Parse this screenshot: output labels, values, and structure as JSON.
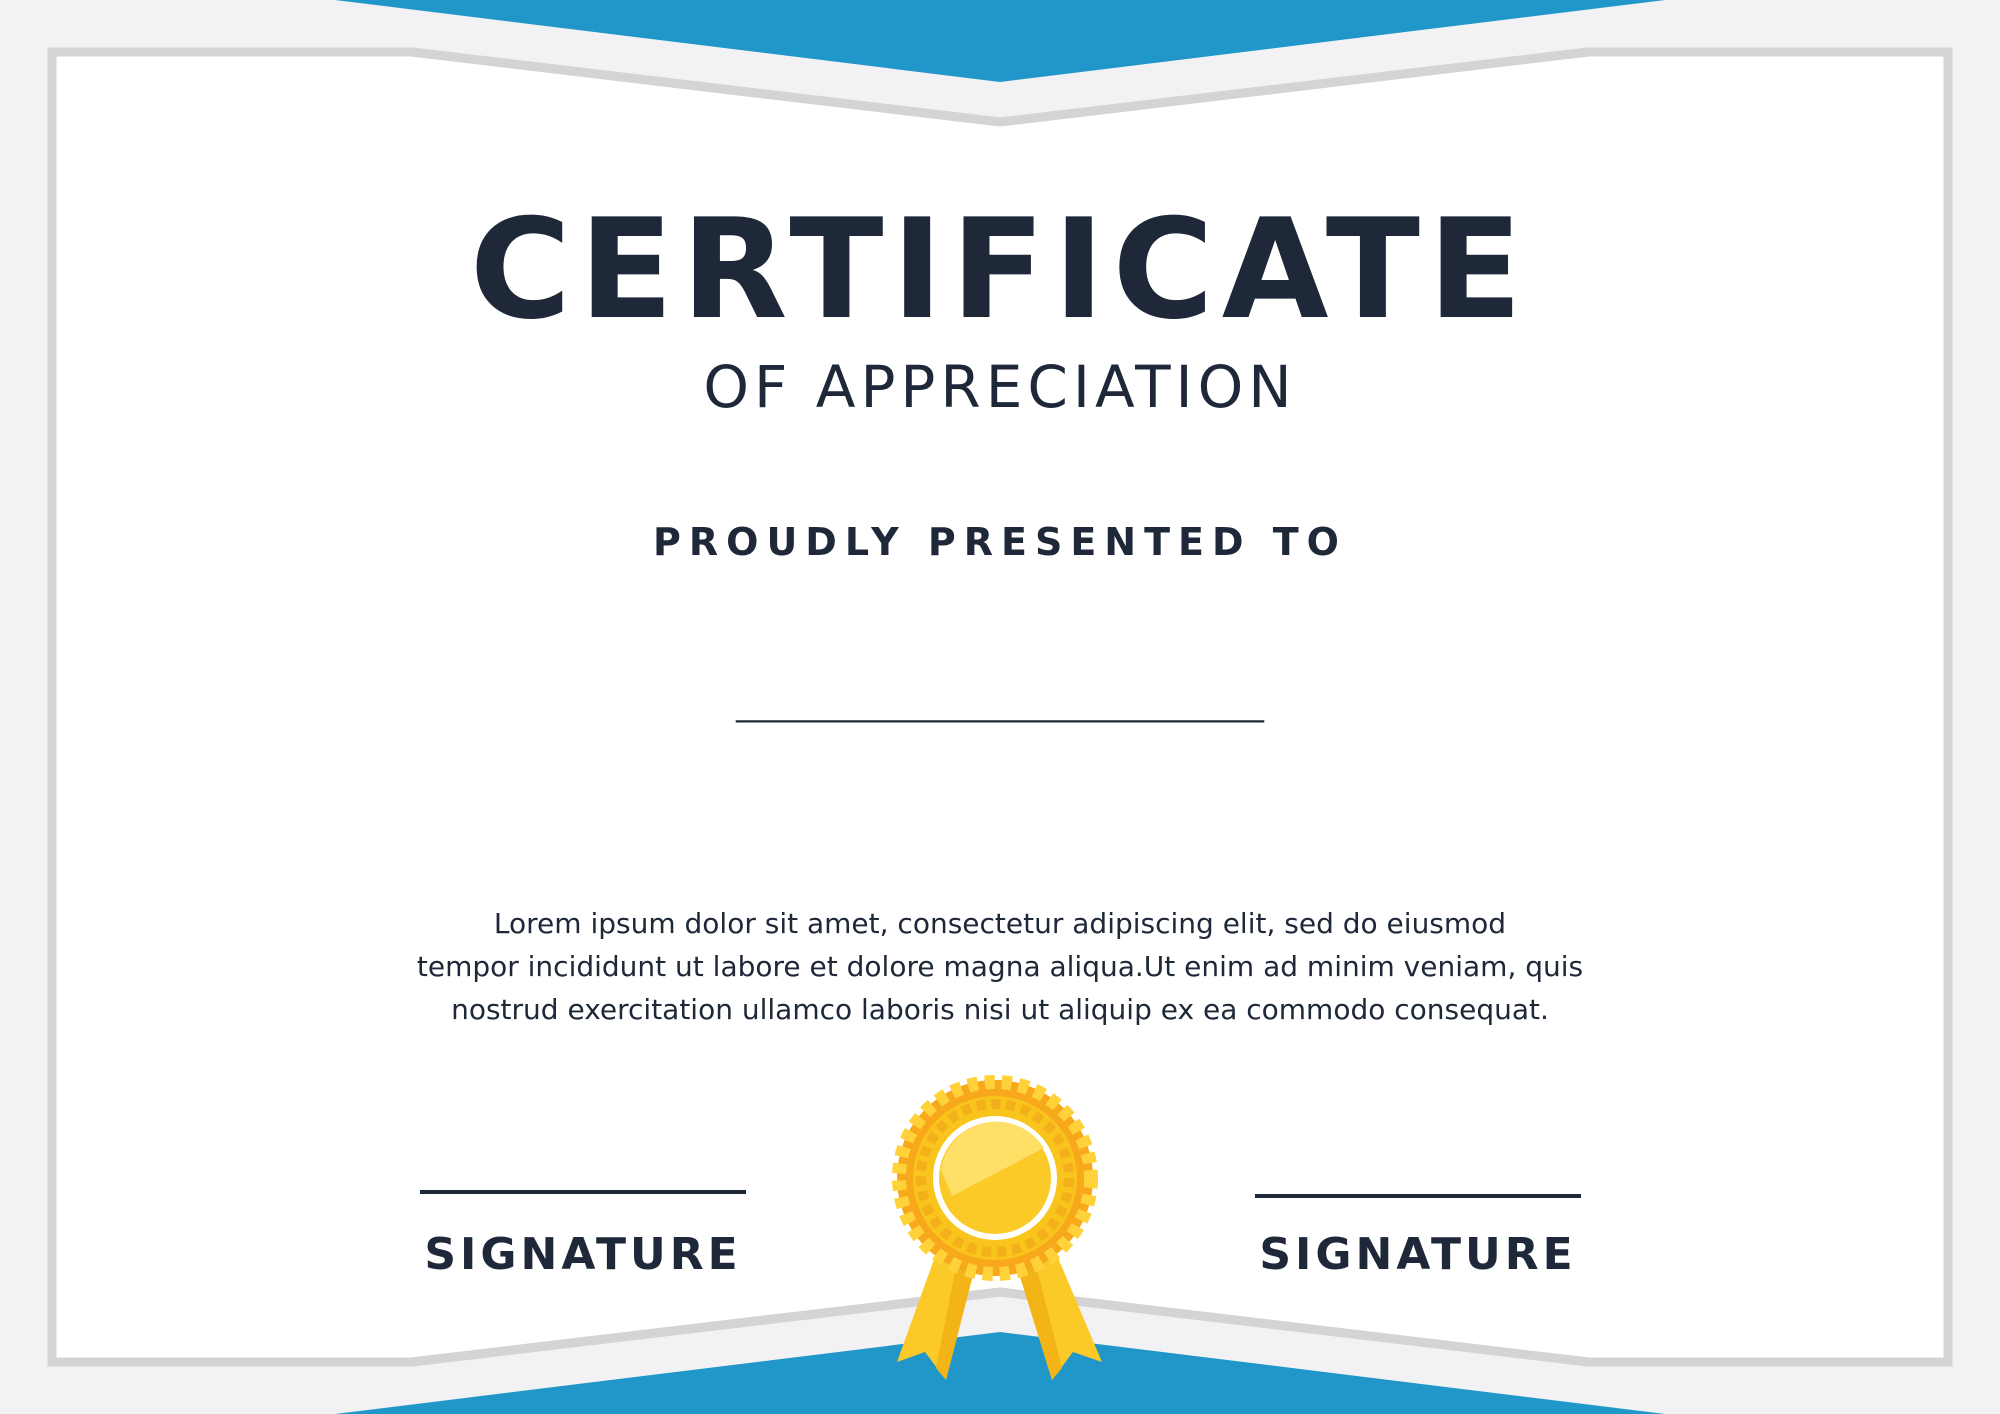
{
  "certificate": {
    "title": "CERTIFICATE",
    "subtitle": "OF APPRECIATION",
    "presented_to": "PROUDLY PRESENTED TO",
    "name_placeholder": "_________________________________",
    "body_lines": [
      "Lorem ipsum dolor sit amet, consectetur adipiscing elit, sed do eiusmod",
      "tempor incididunt ut labore et dolore magna aliqua.Ut enim ad minim veniam, quis",
      "nostrud exercitation ullamco laboris nisi ut aliquip ex ea commodo consequat."
    ],
    "signature_left": "SIGNATURE",
    "signature_right": "SIGNATURE",
    "badge_icon": "gold-rosette-award"
  },
  "colors": {
    "accent_blue": "#2196c8",
    "text_dark": "#1e2838",
    "frame_gray": "#d4d4d6",
    "page_bg": "#f2f2f4",
    "gold": "#f9c51c"
  }
}
